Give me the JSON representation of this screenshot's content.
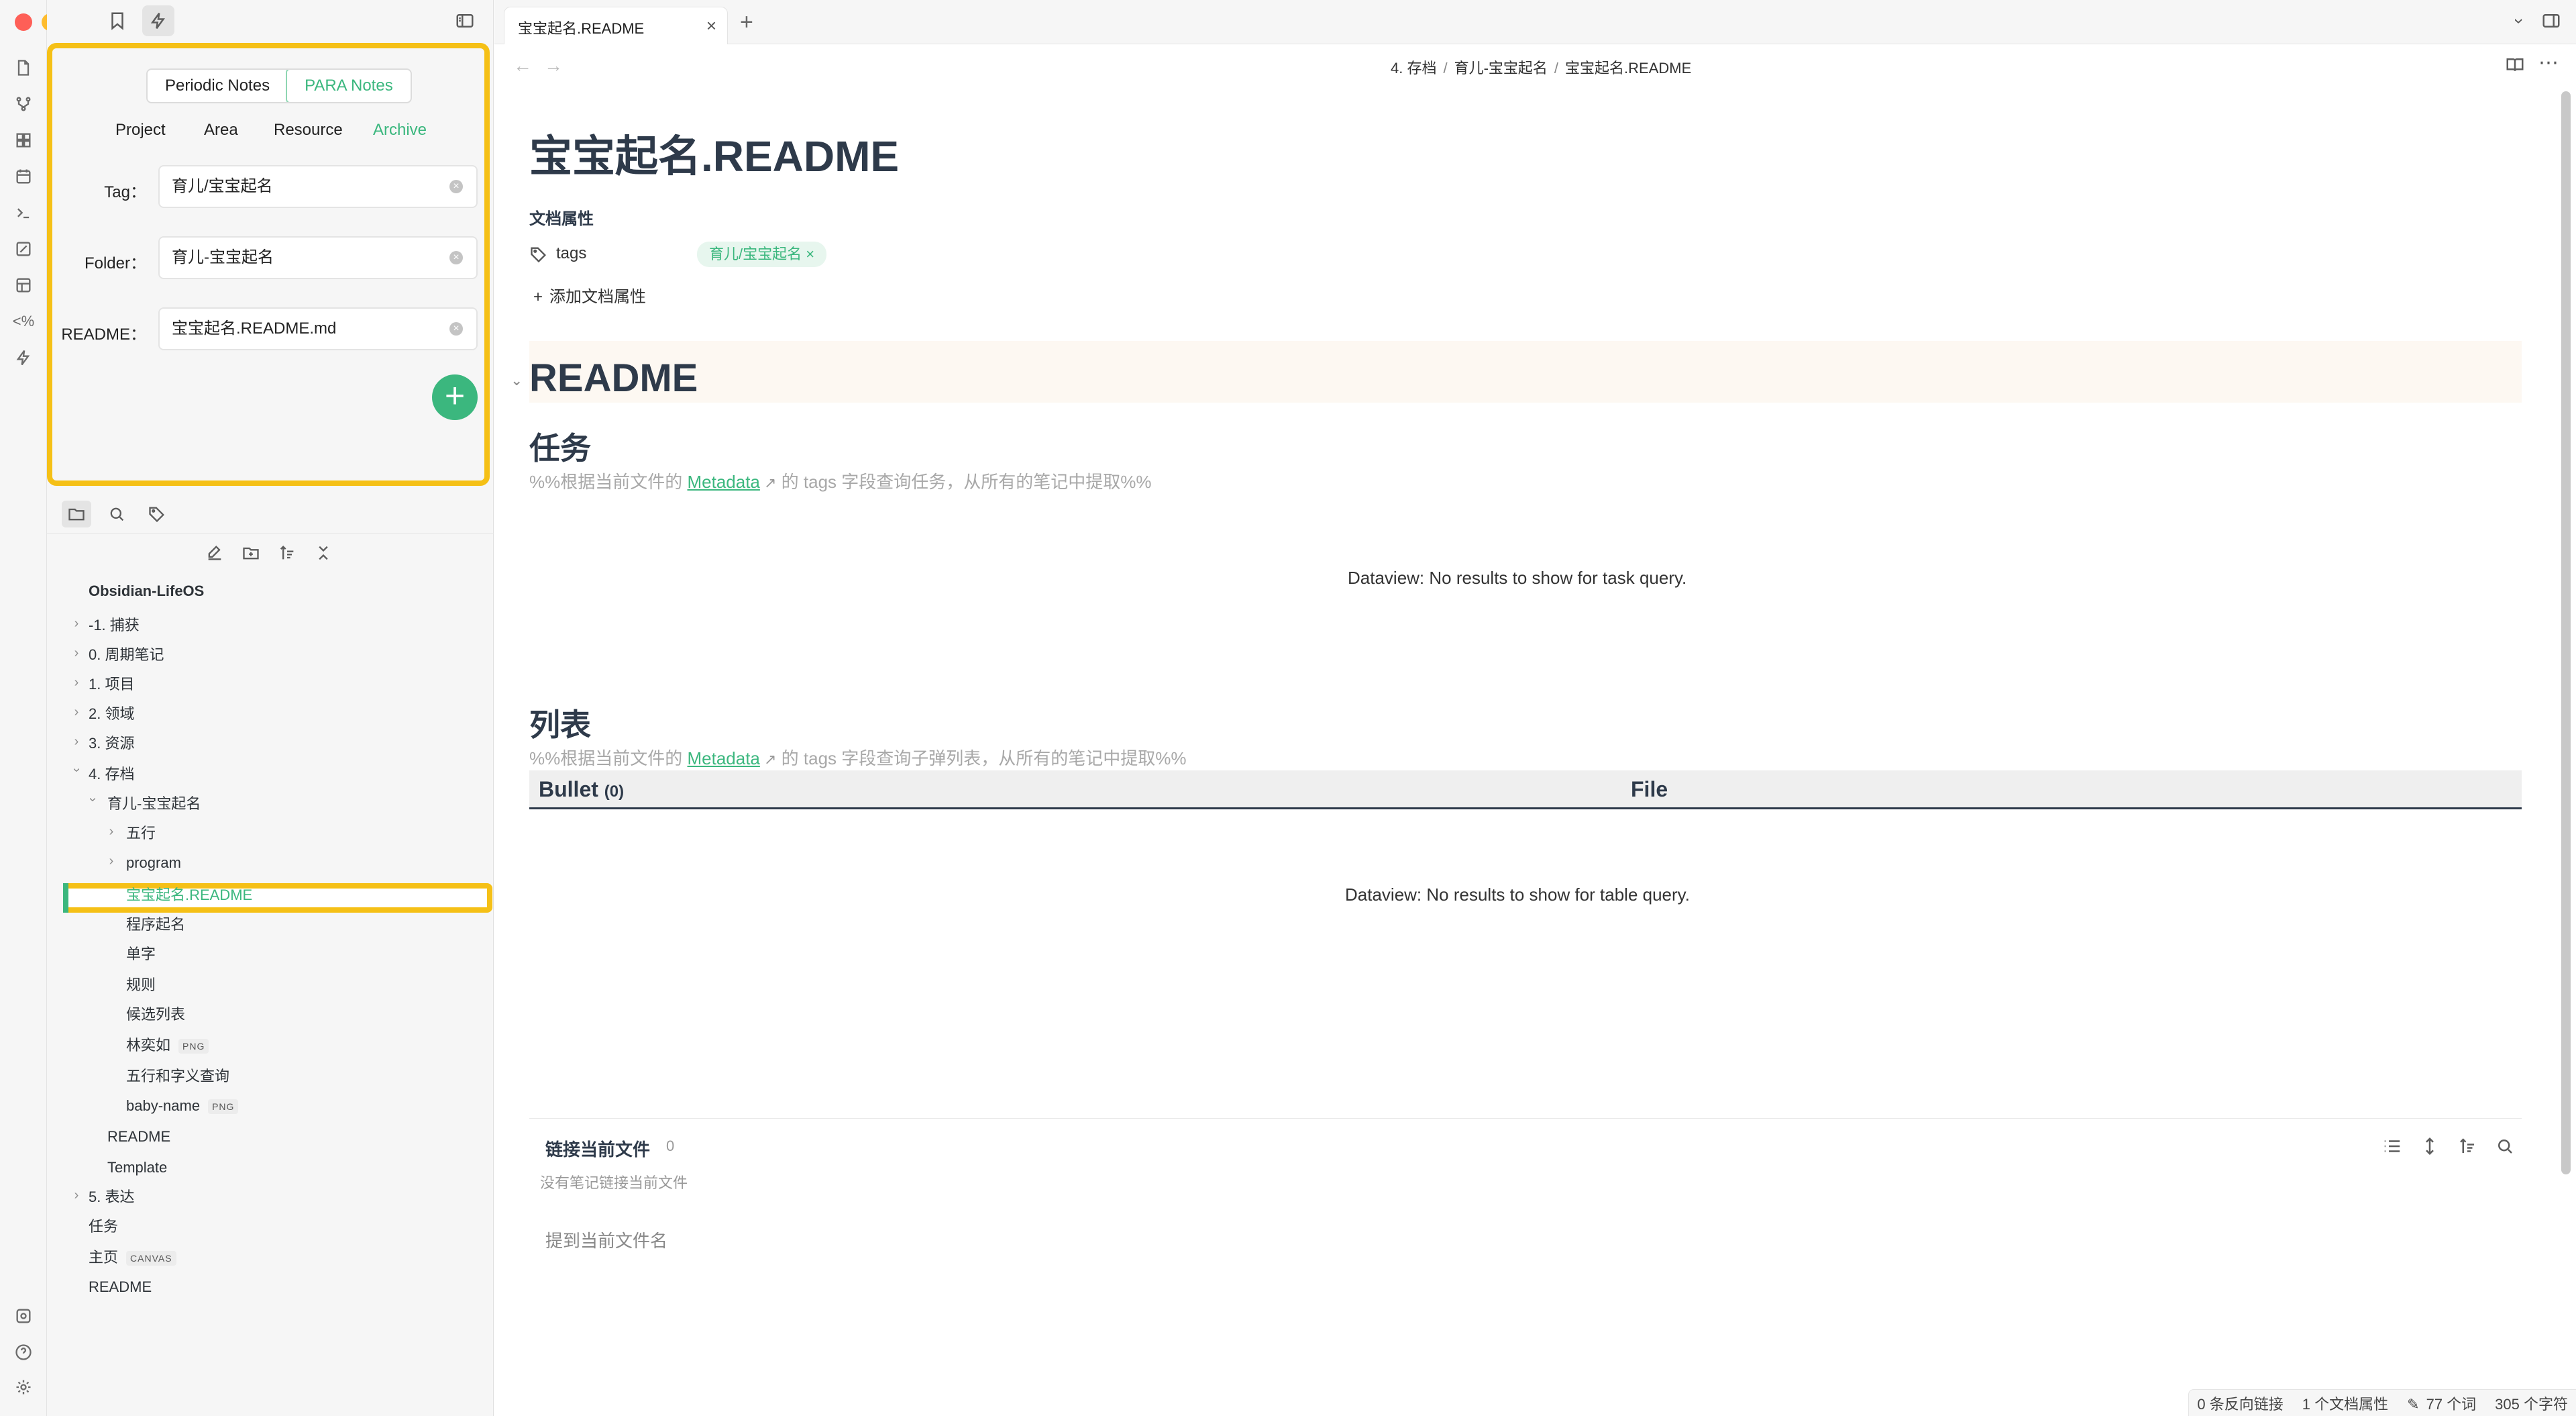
{
  "app": {
    "title_tab": "宝宝起名.README"
  },
  "colors": {
    "accent": "#3bb77e",
    "highlight": "#f5c016",
    "close": "#fe5f57",
    "minimize": "#febc2e",
    "maximize": "#28c840"
  },
  "ribbon": {
    "icons": [
      "file-icon",
      "graph-icon",
      "dashboard-icon",
      "calendar-icon",
      "terminal-icon",
      "canvas-icon",
      "template-icon",
      "percent-code-icon",
      "lightning-icon",
      "vault-icon",
      "help-icon",
      "settings-icon"
    ]
  },
  "para_panel": {
    "segment": [
      "Periodic Notes",
      "PARA Notes"
    ],
    "tabs": [
      "Project",
      "Area",
      "Resource",
      "Archive"
    ],
    "tag_label": "Tag",
    "tag_value": "育儿/宝宝起名",
    "folder_label": "Folder",
    "folder_value": "育儿-宝宝起名",
    "readme_label": "README",
    "readme_value": "宝宝起名.README.md",
    "colon": "："
  },
  "explorer": {
    "vault_name": "Obsidian-LifeOS",
    "items": [
      {
        "label": "-1. 捕获"
      },
      {
        "label": "0. 周期笔记"
      },
      {
        "label": "1. 项目"
      },
      {
        "label": "2. 领域"
      },
      {
        "label": "3. 资源"
      },
      {
        "label": "4. 存档"
      },
      {
        "label": "育儿-宝宝起名"
      },
      {
        "label": "五行"
      },
      {
        "label": "program"
      },
      {
        "label": "宝宝起名.README"
      },
      {
        "label": "程序起名"
      },
      {
        "label": "单字"
      },
      {
        "label": "规则"
      },
      {
        "label": "候选列表"
      },
      {
        "label": "林奕如",
        "badge": "PNG"
      },
      {
        "label": "五行和字义查询"
      },
      {
        "label": "baby-name",
        "badge": "PNG"
      },
      {
        "label": "README"
      },
      {
        "label": "Template"
      },
      {
        "label": "5. 表达"
      },
      {
        "label": "任务"
      },
      {
        "label": "主页",
        "badge": "CANVAS"
      },
      {
        "label": "README"
      }
    ]
  },
  "breadcrumb": [
    "4. 存档",
    "育儿-宝宝起名",
    "宝宝起名.README"
  ],
  "breadcrumb_sep": "/",
  "document": {
    "title": "宝宝起名.README",
    "properties_heading": "文档属性",
    "prop_key": "tags",
    "prop_tag": "育儿/宝宝起名",
    "add_property": "添加文档属性",
    "h1": "README",
    "task_heading": "任务",
    "task_comment_pre": "%%根据当前文件的",
    "task_comment_link": "Metadata",
    "task_comment_post": "的 tags 字段查询任务，从所有的笔记中提取%%",
    "task_result": "Dataview: No results to show for task query.",
    "list_heading": "列表",
    "list_comment_pre": "%%根据当前文件的",
    "list_comment_link": "Metadata",
    "list_comment_post": "的 tags 字段查询子弹列表，从所有的笔记中提取%%",
    "table_col1": "Bullet",
    "table_col1_count": "(0)",
    "table_col2": "File",
    "table_result": "Dataview: No results to show for table query."
  },
  "backlinks": {
    "title": "链接当前文件",
    "count": "0",
    "empty": "没有笔记链接当前文件",
    "unlinked": "提到当前文件名"
  },
  "status": {
    "backlinks": "0 条反向链接",
    "properties": "1 个文档属性",
    "words": "77 个词",
    "chars": "305 个字符"
  }
}
